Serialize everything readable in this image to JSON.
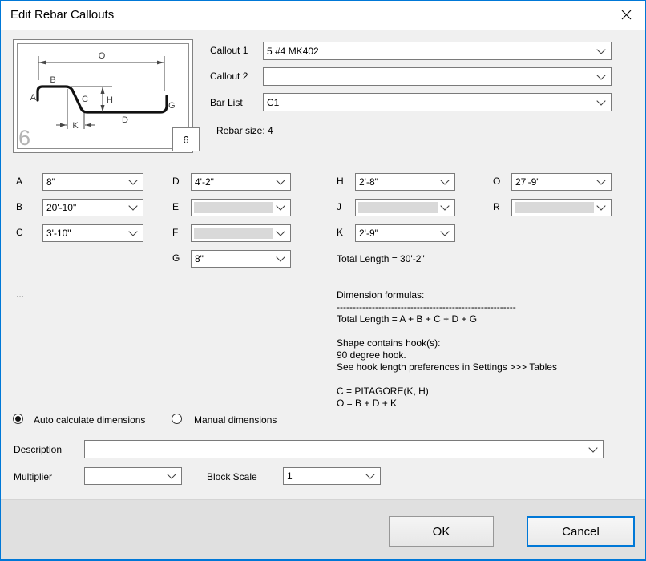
{
  "window": {
    "title": "Edit Rebar Callouts"
  },
  "colors": {
    "accent": "#0078d7",
    "dialog_bg": "#f0f0f0",
    "footer_bg": "#e0e0e0",
    "disabled_fill": "#d9d9d9"
  },
  "diagram": {
    "shape_labels": {
      "A": "A",
      "B": "B",
      "C": "C",
      "D": "D",
      "G": "G",
      "H": "H",
      "K": "K",
      "O": "O"
    },
    "watermark_number": "6",
    "size_box_value": "6"
  },
  "callouts": {
    "callout1_label": "Callout 1",
    "callout1_value": "5 #4 MK402",
    "callout2_label": "Callout 2",
    "callout2_value": "",
    "bar_list_label": "Bar List",
    "bar_list_value": "C1",
    "rebar_size_text": "Rebar size: 4"
  },
  "dimensions": {
    "A": {
      "label": "A",
      "value": "8\""
    },
    "B": {
      "label": "B",
      "value": "20'-10\""
    },
    "C": {
      "label": "C",
      "value": "3'-10\""
    },
    "D": {
      "label": "D",
      "value": "4'-2\""
    },
    "E": {
      "label": "E",
      "value": ""
    },
    "F": {
      "label": "F",
      "value": ""
    },
    "G": {
      "label": "G",
      "value": "8\""
    },
    "H": {
      "label": "H",
      "value": "2'-8\""
    },
    "J": {
      "label": "J",
      "value": ""
    },
    "K": {
      "label": "K",
      "value": "2'-9\""
    },
    "O": {
      "label": "O",
      "value": "27'-9\""
    },
    "R": {
      "label": "R",
      "value": ""
    }
  },
  "total_length_text": "Total Length = 30'-2\"",
  "ellipsis_text": "...",
  "formulas": {
    "lines": [
      "Dimension formulas:",
      "--------------------------------------------------------",
      "Total Length = A + B + C + D + G",
      "",
      "Shape contains hook(s):",
      "90 degree hook.",
      "See hook length preferences in Settings >>> Tables",
      "",
      "C = PITAGORE(K, H)",
      "O = B + D + K"
    ]
  },
  "calc_mode": {
    "auto_label": "Auto calculate dimensions",
    "manual_label": "Manual dimensions",
    "selected": "auto"
  },
  "description": {
    "label": "Description",
    "value": ""
  },
  "multiplier": {
    "label": "Multiplier",
    "value": ""
  },
  "block_scale": {
    "label": "Block Scale",
    "value": "1"
  },
  "footer": {
    "ok_label": "OK",
    "cancel_label": "Cancel"
  }
}
